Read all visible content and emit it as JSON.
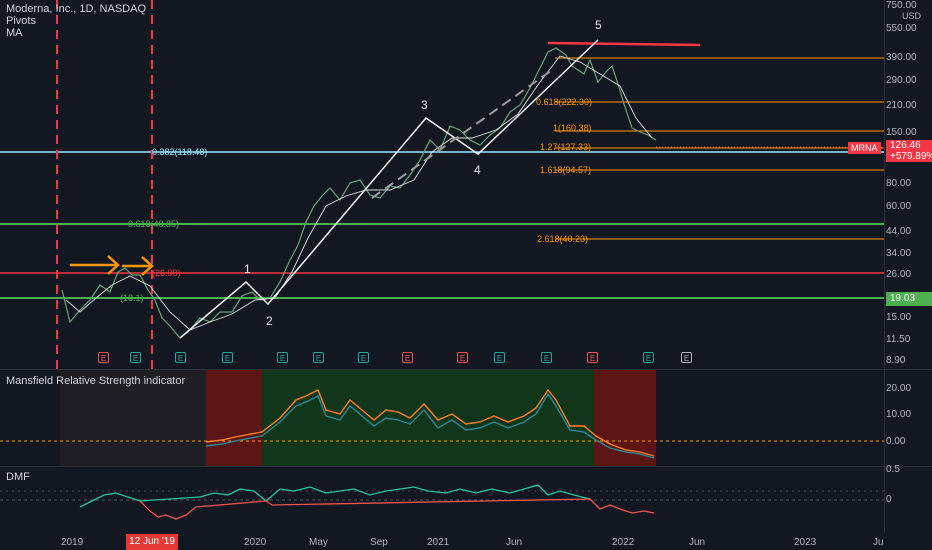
{
  "legend": {
    "symbol": "Moderna, Inc., 1D, NASDAQ",
    "pivots": "Pivots",
    "ma": "MA"
  },
  "currency": "USD",
  "price_axis": {
    "ticks": [
      "750.00",
      "550.00",
      "390.00",
      "290.00",
      "210.00",
      "150.00",
      "80.00",
      "60.00",
      "44.00",
      "34.00",
      "26.00",
      "15.00",
      "11.50",
      "8.90"
    ],
    "current_price": "126.46",
    "change": "+579.89%",
    "ticker": "MRNA",
    "green_line_label": "19.03"
  },
  "fib_levels": [
    "0.618(222.30)",
    "1(160.38)",
    "1.27(127.33)",
    "1.618(94.57)",
    "2.618(40.23)",
    "0.382(118.48)",
    "0.618(48.85)",
    "(26.00)",
    "(18.1)"
  ],
  "wave_labels": [
    "1",
    "2",
    "3",
    "4",
    "5"
  ],
  "earnings_badges": [
    "E",
    "E",
    "E",
    "E",
    "E",
    "E",
    "E",
    "E",
    "E",
    "E",
    "E",
    "E",
    "E",
    "E"
  ],
  "rs_panel": {
    "title": "Mansfield Relative Strength indicator",
    "ticks": [
      "20.00",
      "10.00",
      "0.00"
    ]
  },
  "dmf_panel": {
    "title": "DMF",
    "ticks": [
      "0.5",
      "0"
    ]
  },
  "time_axis": {
    "labels": [
      "2019",
      "2020",
      "May",
      "Sep",
      "2021",
      "Jun",
      "2022",
      "Jun",
      "2023",
      "Ju"
    ],
    "selected_date": "12 Jun '19"
  },
  "colors": {
    "background": "#131722",
    "up": "#26a69a",
    "down": "#ef5350",
    "fib": "#ff9800",
    "cyan_line": "#9be7ff",
    "green_line": "#4caf50",
    "red_line": "#f23645"
  }
}
